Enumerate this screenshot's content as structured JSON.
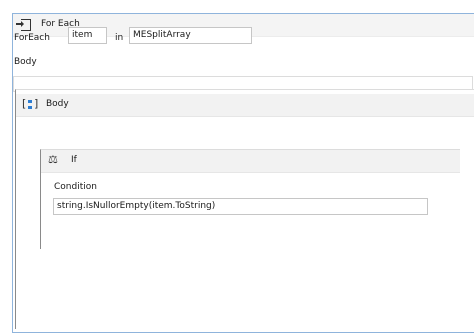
{
  "foreach": {
    "title": "For Each",
    "foreach_label": "ForEach",
    "item_value": "item",
    "in_label": "in",
    "collection_value": "MESplitArray",
    "body_label": "Body",
    "icon": "foreach-icon"
  },
  "sequence": {
    "title": "Body",
    "icon": "sequence-icon"
  },
  "if_activity": {
    "title": "If",
    "icon": "if-icon",
    "condition_label": "Condition",
    "condition_value": "string.IsNullorEmpty(item.ToString)"
  }
}
